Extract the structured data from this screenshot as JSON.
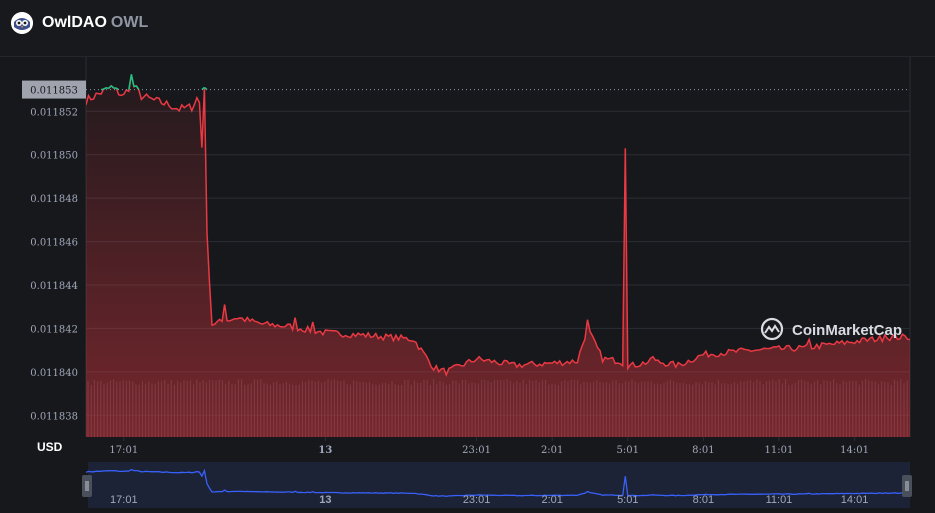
{
  "header": {
    "name": "OwlDAO",
    "symbol": "OWL"
  },
  "currency_label": "USD",
  "watermark": "CoinMarketCap",
  "colors": {
    "background": "#17181b",
    "line_down": "#ea3943",
    "line_up": "#16c784",
    "navigator": "#3861fb",
    "grid": "#2b2e35",
    "axis_text": "#a1a7bb"
  },
  "chart_data": {
    "type": "area",
    "title": "",
    "current_price": "0.011853",
    "xlabel": "",
    "ylabel": "",
    "ylim": [
      0.011837,
      0.0118545
    ],
    "y_ticks": [
      "0.011852",
      "0.011850",
      "0.011848",
      "0.011846",
      "0.011844",
      "0.011842",
      "0.011840",
      "0.011838"
    ],
    "y_tick_values": [
      0.011852,
      0.01185,
      0.011848,
      0.011846,
      0.011844,
      0.011842,
      0.01184,
      0.011838
    ],
    "x_ticks": [
      "17:01",
      "13",
      "23:01",
      "2:01",
      "5:01",
      "8:01",
      "11:01",
      "14:01"
    ],
    "x_tick_hours": [
      1,
      9,
      15,
      18,
      21,
      24,
      27,
      30
    ],
    "x_range_hours": [
      -0.5,
      32.2
    ],
    "baseline_price": 0.011853,
    "series": [
      {
        "name": "",
        "x_hours": [
          -0.5,
          0.5,
          1.0,
          1.3,
          1.7,
          2.2,
          2.8,
          3.2,
          3.7,
          3.9,
          4.0,
          4.5,
          5.5,
          6.5,
          7.5,
          9.0,
          10.5,
          11.5,
          12.5,
          13.3,
          13.8,
          15.0,
          16.5,
          18.0,
          19.0,
          19.4,
          20.0,
          20.7,
          20.9,
          21.2,
          22.0,
          23.0,
          24.0,
          26.0,
          28.0,
          30.0,
          31.5,
          32.2
        ],
        "y": [
          0.0118525,
          0.0118531,
          0.0118527,
          0.0118533,
          0.0118527,
          0.0118525,
          0.0118523,
          0.0118521,
          0.0118522,
          0.0118526,
          0.0118524,
          0.0118422,
          0.0118425,
          0.0118422,
          0.0118421,
          0.0118418,
          0.0118417,
          0.0118416,
          0.0118415,
          0.0118402,
          0.01184,
          0.0118406,
          0.0118403,
          0.0118404,
          0.0118405,
          0.011842,
          0.0118406,
          0.0118405,
          0.0118403,
          0.0118403,
          0.0118405,
          0.0118403,
          0.0118408,
          0.011841,
          0.0118411,
          0.0118414,
          0.0118416,
          0.0118416
        ],
        "events": [
          {
            "x": 1.3,
            "y": 0.0118537
          },
          {
            "x": 4.2,
            "y": 0.0118531
          },
          {
            "x": 5.0,
            "y": 0.0118431
          },
          {
            "x": 7.8,
            "y": 0.0118425
          },
          {
            "x": 8.5,
            "y": 0.0118423
          },
          {
            "x": 19.4,
            "y": 0.0118424
          },
          {
            "x": 20.9,
            "y": 0.0118503
          },
          {
            "x": 22.0,
            "y": 0.0118407
          },
          {
            "x": 28.2,
            "y": 0.0118415
          },
          {
            "x": 31.2,
            "y": 0.0118417
          }
        ]
      }
    ]
  }
}
